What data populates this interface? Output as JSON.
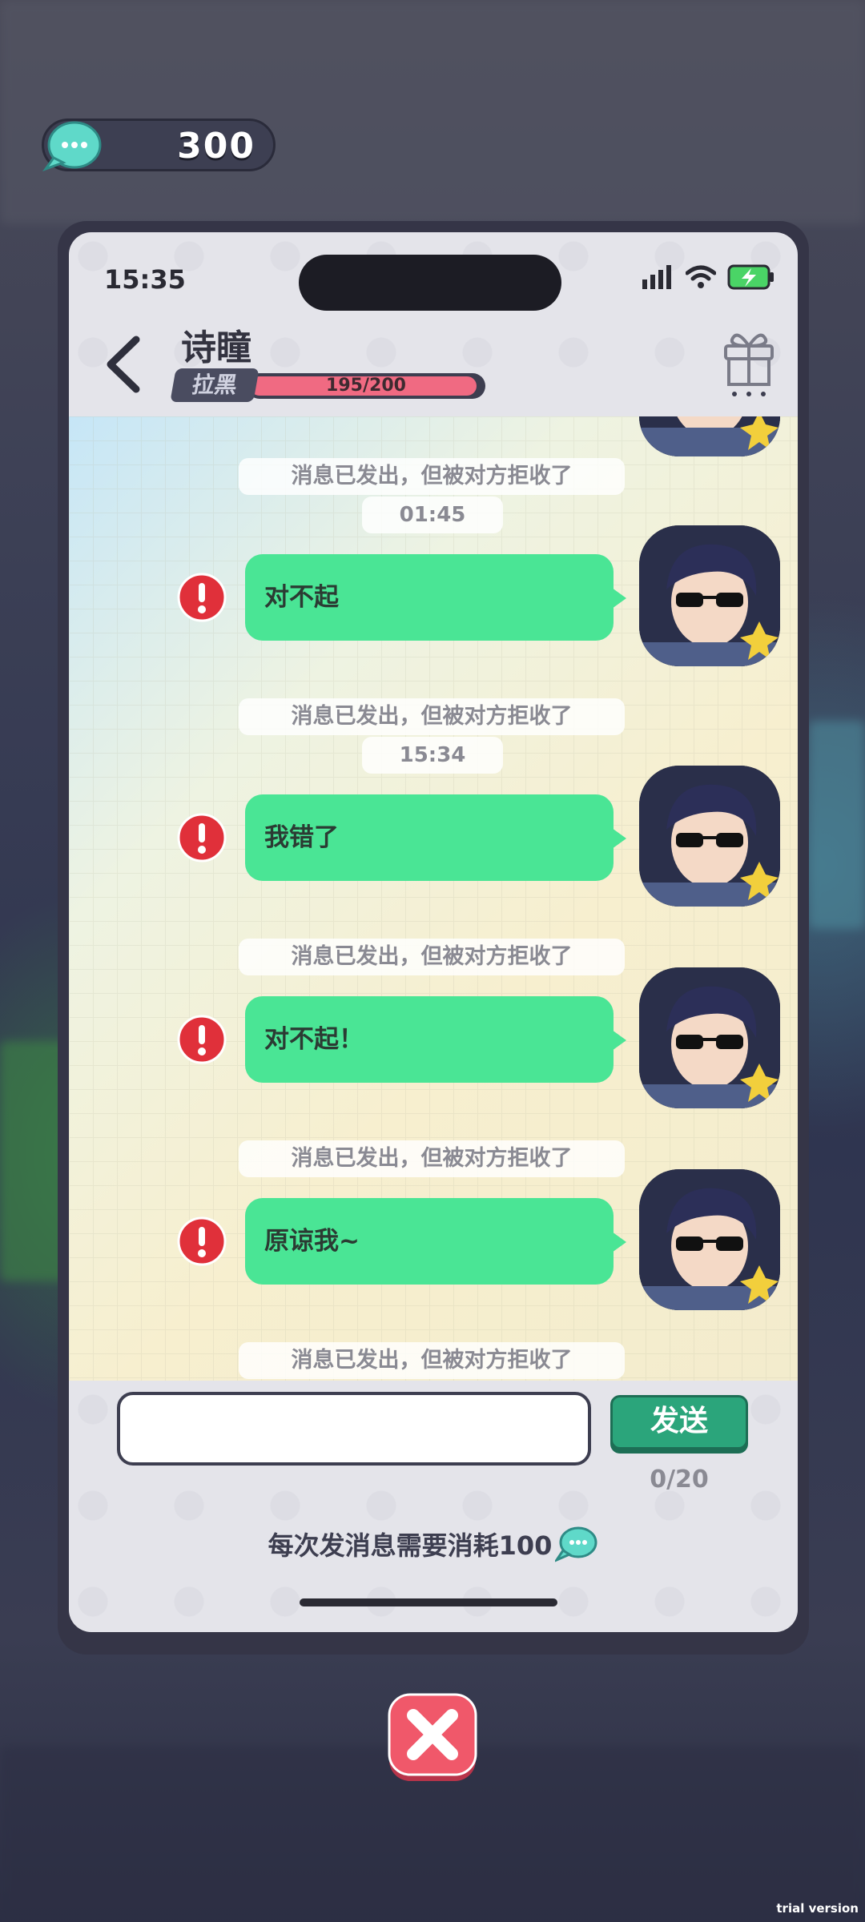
{
  "currency": {
    "icon": "chat-bubble-icon",
    "value": "300"
  },
  "status_bar": {
    "time": "15:35",
    "icons": [
      "signal-icon",
      "wifi-icon",
      "battery-charging-icon"
    ]
  },
  "header": {
    "back_icon": "chevron-left-icon",
    "contact_name": "诗瞳",
    "block_label": "拉黑",
    "favor_text": "195/200",
    "favor_fraction": 0.975,
    "gift_icon": "gift-icon"
  },
  "chat": {
    "system_messages": [
      "消息已发出，但被对方拒收了",
      "消息已发出，但被对方拒收了",
      "消息已发出，但被对方拒收了",
      "消息已发出，但被对方拒收了",
      "消息已发出，但被对方拒收了"
    ],
    "timestamps": [
      "01:45",
      "15:34"
    ],
    "messages": [
      {
        "text": "对不起",
        "status": "rejected"
      },
      {
        "text": "我错了",
        "status": "rejected"
      },
      {
        "text": "对不起！",
        "status": "rejected"
      },
      {
        "text": "原谅我~",
        "status": "rejected"
      }
    ]
  },
  "composer": {
    "input_value": "",
    "send_label": "发送",
    "char_count": "0/20",
    "cost_note": "每次发消息需要消耗100"
  },
  "close_icon": "close-x-icon",
  "watermark": "trial version",
  "colors": {
    "bubble": "#4ae595",
    "send": "#2ba57b",
    "favor": "#f06a82",
    "alert": "#e0303a",
    "close": "#f0586a"
  }
}
